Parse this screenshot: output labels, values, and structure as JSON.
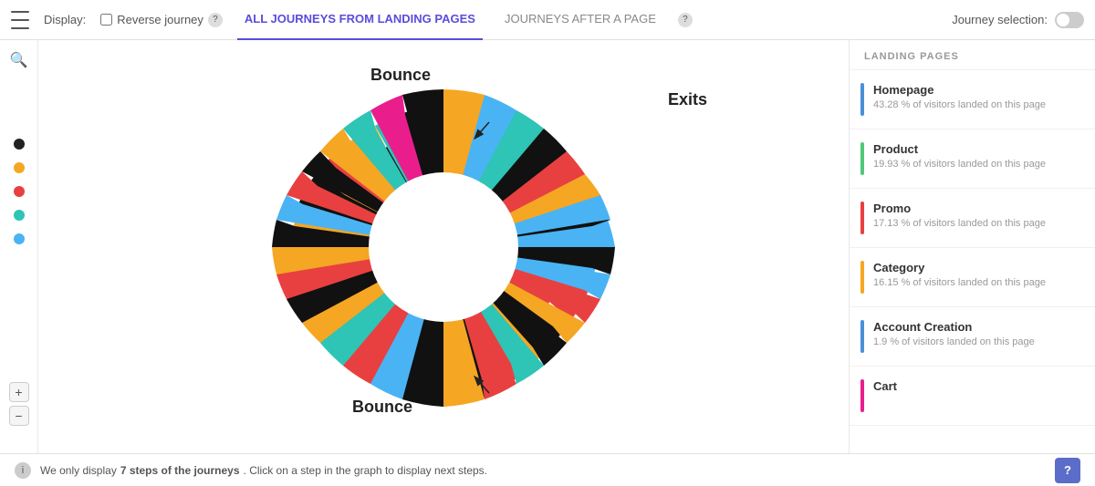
{
  "topbar": {
    "display_label": "Display:",
    "reverse_journey_label": "Reverse journey",
    "tab_all": "ALL JOURNEYS FROM LANDING PAGES",
    "tab_journeys_after": "JOURNEYS AFTER A PAGE",
    "journey_selection_label": "Journey selection:"
  },
  "chart": {
    "bounce_top_label": "Bounce",
    "exits_label": "Exits",
    "bounce_bottom_label": "Bounce"
  },
  "landing_pages": {
    "header": "LANDING PAGES",
    "items": [
      {
        "name": "Homepage",
        "stat": "43.28 % of visitors landed on this page",
        "color": "#4a90d9"
      },
      {
        "name": "Product",
        "stat": "19.93 % of visitors landed on this page",
        "color": "#50c87a"
      },
      {
        "name": "Promo",
        "stat": "17.13 % of visitors landed on this page",
        "color": "#e84040"
      },
      {
        "name": "Category",
        "stat": "16.15 % of visitors landed on this page",
        "color": "#f5a623"
      },
      {
        "name": "Account Creation",
        "stat": "1.9 % of visitors landed on this page",
        "color": "#4a90d9"
      },
      {
        "name": "Cart",
        "stat": "",
        "color": "#e91e8c"
      }
    ]
  },
  "dots": [
    {
      "color": "#222"
    },
    {
      "color": "#f5a623"
    },
    {
      "color": "#e84040"
    },
    {
      "color": "#2ec4b6"
    },
    {
      "color": "#4ab3f4"
    }
  ],
  "bottombar": {
    "text_normal": "We only display ",
    "text_bold": "7 steps of the journeys",
    "text_rest": ". Click on a step in the graph to display next steps."
  },
  "zoom": {
    "plus": "+",
    "minus": "−"
  }
}
